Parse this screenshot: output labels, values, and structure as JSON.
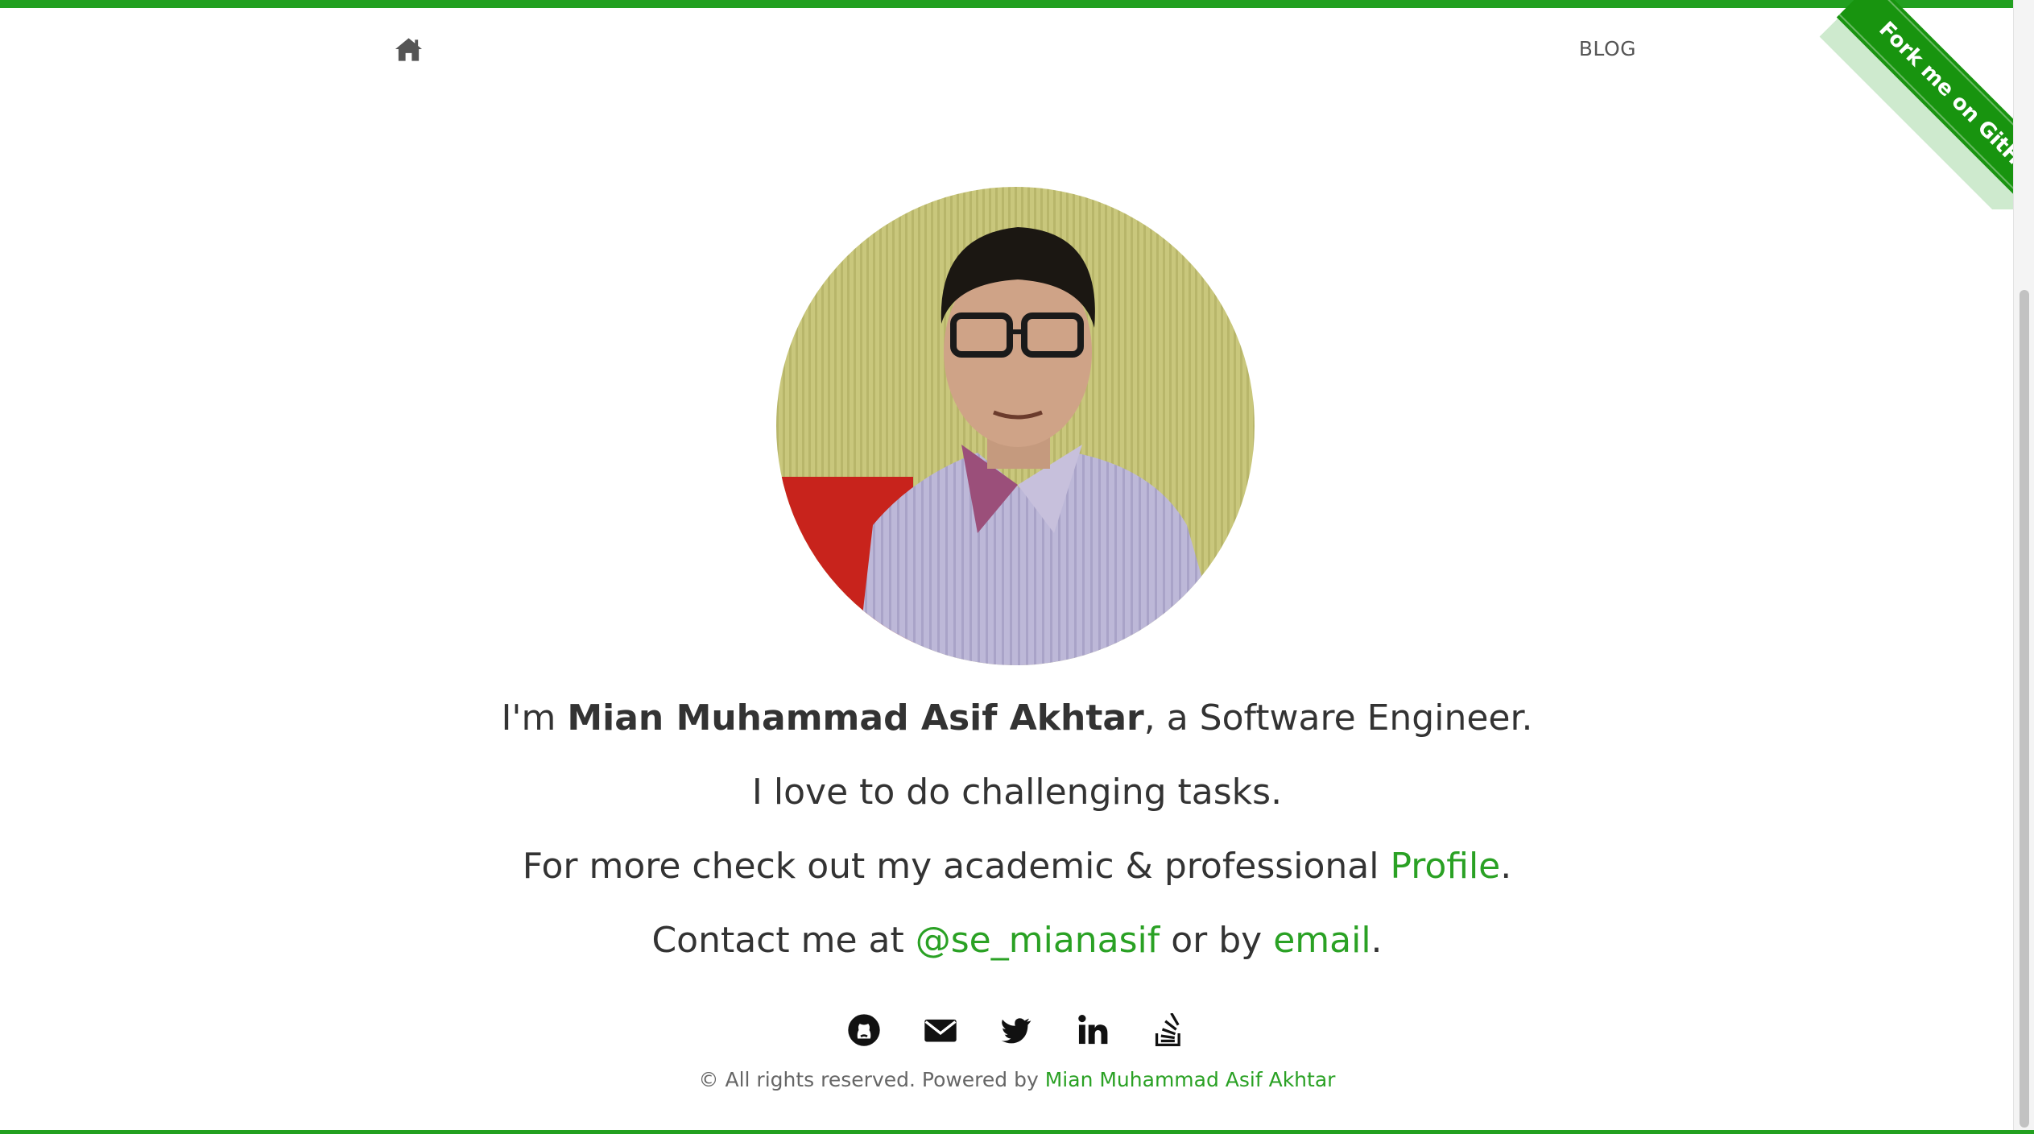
{
  "colors": {
    "accent": "#22a020",
    "link": "#2aa124",
    "text": "#333333"
  },
  "nav": {
    "home_icon": "home-icon",
    "blog_label": "BLOG"
  },
  "ribbon": {
    "label": "Fork me on GitHub"
  },
  "intro": {
    "line1_prefix": "I'm ",
    "name": "Mian Muhammad Asif Akhtar",
    "line1_suffix": ", a Software Engineer.",
    "line2": "I love to do challenging tasks.",
    "line3_prefix": "For more check out my academic & professional ",
    "profile_link": "Profile",
    "line3_suffix": ".",
    "line4_prefix": "Contact me at ",
    "twitter_handle": "@se_mianasif",
    "line4_middle": " or by ",
    "email_link": "email",
    "line4_suffix": "."
  },
  "social": [
    "github-icon",
    "envelope-icon",
    "twitter-icon",
    "linkedin-icon",
    "stackoverflow-icon"
  ],
  "footer": {
    "text": "© All rights reserved. Powered by ",
    "author": "Mian Muhammad Asif Akhtar"
  }
}
